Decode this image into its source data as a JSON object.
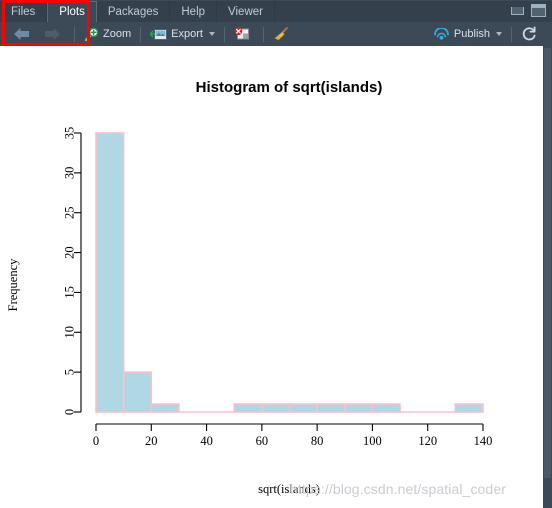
{
  "window": {
    "minimize_label": "minimize",
    "maximize_label": "maximize"
  },
  "tabs": [
    {
      "label": "Files",
      "active": false
    },
    {
      "label": "Plots",
      "active": true
    },
    {
      "label": "Packages",
      "active": false
    },
    {
      "label": "Help",
      "active": false
    },
    {
      "label": "Viewer",
      "active": false
    }
  ],
  "toolbar": {
    "back_label": "",
    "forward_label": "",
    "zoom_label": "Zoom",
    "export_label": "Export",
    "remove_label": "",
    "clear_all_label": "",
    "publish_label": "Publish",
    "refresh_label": ""
  },
  "annotation": {
    "highlight_color": "#ff0000"
  },
  "watermark": {
    "text": "https://blog.csdn.net/spatial_coder"
  },
  "colors": {
    "bar_fill": "#afd8e4",
    "bar_border": "#fbc0cb",
    "axis": "#000000",
    "panel_bg": "#3c4956",
    "tab_inactive_bg": "#34404c",
    "text_light": "#d9e1e8",
    "publish_blue": "#3aa9e0"
  },
  "chart_data": {
    "type": "bar",
    "title": "Histogram of sqrt(islands)",
    "xlabel": "sqrt(islands)",
    "ylabel": "Frequency",
    "xlim": [
      0,
      140
    ],
    "ylim": [
      0,
      35
    ],
    "xticks": [
      0,
      20,
      40,
      60,
      80,
      100,
      120,
      140
    ],
    "yticks": [
      0,
      5,
      10,
      15,
      20,
      25,
      30,
      35
    ],
    "grid": false,
    "legend": "none",
    "bin_width": 10,
    "bins": [
      {
        "x0": 0,
        "x1": 10,
        "count": 35
      },
      {
        "x0": 10,
        "x1": 20,
        "count": 5
      },
      {
        "x0": 20,
        "x1": 30,
        "count": 1
      },
      {
        "x0": 30,
        "x1": 40,
        "count": 0
      },
      {
        "x0": 40,
        "x1": 50,
        "count": 0
      },
      {
        "x0": 50,
        "x1": 60,
        "count": 1
      },
      {
        "x0": 60,
        "x1": 70,
        "count": 1
      },
      {
        "x0": 70,
        "x1": 80,
        "count": 1
      },
      {
        "x0": 80,
        "x1": 90,
        "count": 1
      },
      {
        "x0": 90,
        "x1": 100,
        "count": 1
      },
      {
        "x0": 100,
        "x1": 110,
        "count": 1
      },
      {
        "x0": 110,
        "x1": 120,
        "count": 0
      },
      {
        "x0": 120,
        "x1": 130,
        "count": 0
      },
      {
        "x0": 130,
        "x1": 140,
        "count": 1
      }
    ]
  }
}
